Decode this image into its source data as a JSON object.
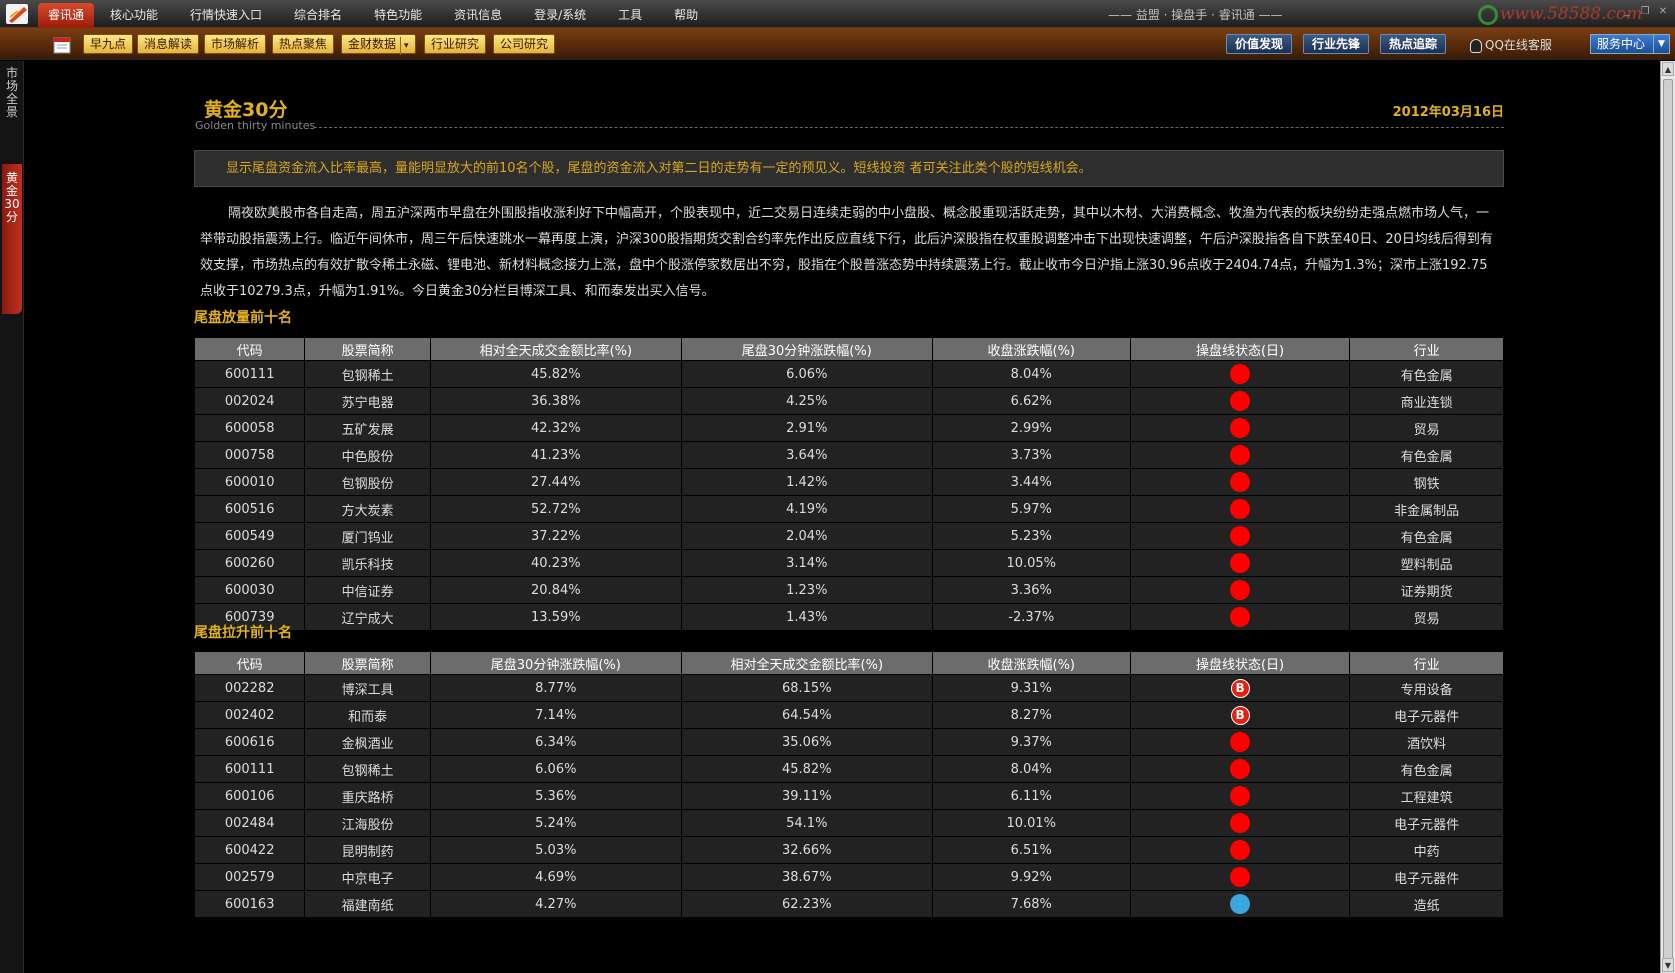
{
  "menubar": {
    "items": [
      "睿讯通",
      "核心功能",
      "行情快速入口",
      "综合排名",
      "特色功能",
      "资讯信息",
      "登录/系统",
      "工具",
      "帮助"
    ],
    "app_title": "—— 益盟 · 操盘手 · 睿讯通 ——",
    "watermark": "www.58588.com"
  },
  "toolbar": {
    "buttons": [
      "早九点",
      "消息解读",
      "市场解析",
      "热点聚焦",
      "金财数据",
      "行业研究",
      "公司研究"
    ],
    "dropdown_arrow": "▾",
    "right_buttons": [
      "价值发现",
      "行业先锋",
      "热点追踪"
    ],
    "qq_label": "QQ在线客服",
    "service_label": "服务中心"
  },
  "left_tabs": [
    "市场全景",
    "黄金30分"
  ],
  "page": {
    "title": "黄金30分",
    "subtitle": "Golden thirty minutes",
    "date": "2012年03月16日",
    "notice": "显示尾盘资金流入比率最高，量能明显放大的前10名个股，尾盘的资金流入对第二日的走势有一定的预见义。短线投资 者可关注此类个股的短线机会。",
    "paragraph": "隔夜欧美股市各自走高，周五沪深两市早盘在外围股指收涨利好下中幅高开，个股表现中，近二交易日连续走弱的中小盘股、概念股重现活跃走势，其中以木材、大消费概念、牧渔为代表的板块纷纷走强点燃市场人气，一举带动股指震荡上行。临近午间休市，周三午后快速跳水一幕再度上演，沪深300股指期货交割合约率先作出反应直线下行，此后沪深股指在权重股调整冲击下出现快速调整，午后沪深股指各自下跌至40日、20日均线后得到有效支撑，市场热点的有效扩散令稀土永磁、锂电池、新材料概念接力上涨，盘中个股涨停家数居出不穷，股指在个股普涨态势中持续震荡上行。截止收市今日沪指上涨30.96点收于2404.74点，升幅为1.3%；深市上涨192.75点收于10279.3点，升幅为1.91%。今日黄金30分栏目博深工具、和而泰发出买入信号。"
  },
  "table1": {
    "title": "尾盘放量前十名",
    "headers": [
      "代码",
      "股票简称",
      "相对全天成交金额比率(%)",
      "尾盘30分钟涨跌幅(%)",
      "收盘涨跌幅(%)",
      "操盘线状态(日)",
      "行业"
    ],
    "rows": [
      {
        "code": "600111",
        "name": "包钢稀土",
        "c3": "45.82%",
        "c4": "6.06%",
        "c5": "8.04%",
        "status": "red",
        "status_text": "",
        "industry": "有色金属"
      },
      {
        "code": "002024",
        "name": "苏宁电器",
        "c3": "36.38%",
        "c4": "4.25%",
        "c5": "6.62%",
        "status": "red",
        "status_text": "",
        "industry": "商业连锁"
      },
      {
        "code": "600058",
        "name": "五矿发展",
        "c3": "42.32%",
        "c4": "2.91%",
        "c5": "2.99%",
        "status": "red",
        "status_text": "",
        "industry": "贸易"
      },
      {
        "code": "000758",
        "name": "中色股份",
        "c3": "41.23%",
        "c4": "3.64%",
        "c5": "3.73%",
        "status": "red",
        "status_text": "",
        "industry": "有色金属"
      },
      {
        "code": "600010",
        "name": "包钢股份",
        "c3": "27.44%",
        "c4": "1.42%",
        "c5": "3.44%",
        "status": "red",
        "status_text": "",
        "industry": "钢铁"
      },
      {
        "code": "600516",
        "name": "方大炭素",
        "c3": "52.72%",
        "c4": "4.19%",
        "c5": "5.97%",
        "status": "red",
        "status_text": "",
        "industry": "非金属制品"
      },
      {
        "code": "600549",
        "name": "厦门钨业",
        "c3": "37.22%",
        "c4": "2.04%",
        "c5": "5.23%",
        "status": "red",
        "status_text": "",
        "industry": "有色金属"
      },
      {
        "code": "600260",
        "name": "凯乐科技",
        "c3": "40.23%",
        "c4": "3.14%",
        "c5": "10.05%",
        "status": "red",
        "status_text": "",
        "industry": "塑料制品"
      },
      {
        "code": "600030",
        "name": "中信证券",
        "c3": "20.84%",
        "c4": "1.23%",
        "c5": "3.36%",
        "status": "red",
        "status_text": "",
        "industry": "证券期货"
      },
      {
        "code": "600739",
        "name": "辽宁成大",
        "c3": "13.59%",
        "c4": "1.43%",
        "c5": "-2.37%",
        "status": "red",
        "status_text": "",
        "industry": "贸易"
      }
    ]
  },
  "table2": {
    "title": "尾盘拉升前十名",
    "headers": [
      "代码",
      "股票简称",
      "尾盘30分钟涨跌幅(%)",
      "相对全天成交金额比率(%)",
      "收盘涨跌幅(%)",
      "操盘线状态(日)",
      "行业"
    ],
    "rows": [
      {
        "code": "002282",
        "name": "博深工具",
        "c3": "8.77%",
        "c4": "68.15%",
        "c5": "9.31%",
        "status": "b",
        "status_text": "B",
        "industry": "专用设备"
      },
      {
        "code": "002402",
        "name": "和而泰",
        "c3": "7.14%",
        "c4": "64.54%",
        "c5": "8.27%",
        "status": "b",
        "status_text": "B",
        "industry": "电子元器件"
      },
      {
        "code": "600616",
        "name": "金枫酒业",
        "c3": "6.34%",
        "c4": "35.06%",
        "c5": "9.37%",
        "status": "red",
        "status_text": "",
        "industry": "酒饮料"
      },
      {
        "code": "600111",
        "name": "包钢稀土",
        "c3": "6.06%",
        "c4": "45.82%",
        "c5": "8.04%",
        "status": "red",
        "status_text": "",
        "industry": "有色金属"
      },
      {
        "code": "600106",
        "name": "重庆路桥",
        "c3": "5.36%",
        "c4": "39.11%",
        "c5": "6.11%",
        "status": "red",
        "status_text": "",
        "industry": "工程建筑"
      },
      {
        "code": "002484",
        "name": "江海股份",
        "c3": "5.24%",
        "c4": "54.1%",
        "c5": "10.01%",
        "status": "red",
        "status_text": "",
        "industry": "电子元器件"
      },
      {
        "code": "600422",
        "name": "昆明制药",
        "c3": "5.03%",
        "c4": "32.66%",
        "c5": "6.51%",
        "status": "red",
        "status_text": "",
        "industry": "中药"
      },
      {
        "code": "002579",
        "name": "中京电子",
        "c3": "4.69%",
        "c4": "38.67%",
        "c5": "9.92%",
        "status": "red",
        "status_text": "",
        "industry": "电子元器件"
      },
      {
        "code": "600163",
        "name": "福建南纸",
        "c3": "4.27%",
        "c4": "62.23%",
        "c5": "7.68%",
        "status": "blue",
        "status_text": "",
        "industry": "造纸"
      }
    ]
  },
  "colors": {
    "accent": "#e0b020",
    "status_red": "#ff0000",
    "status_blue": "#3ca6dc",
    "header_bg": "#6c6c6c",
    "row_bg": "#222222"
  }
}
